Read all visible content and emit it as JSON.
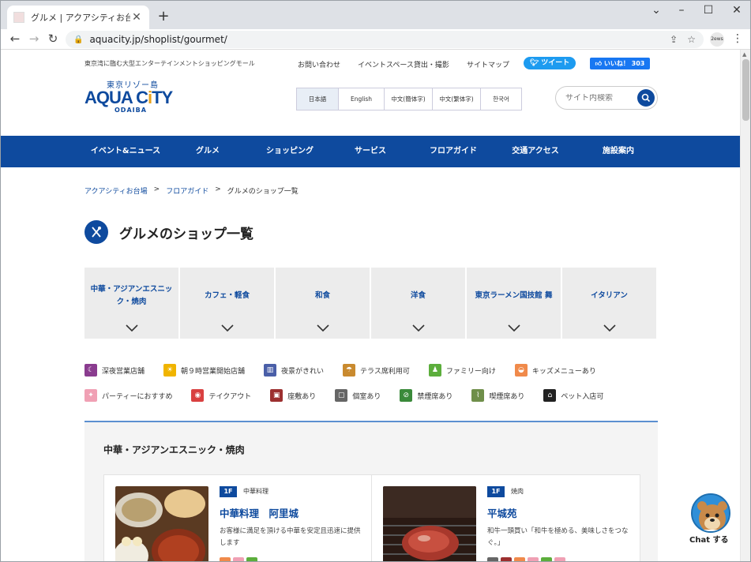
{
  "browser": {
    "tab_title": "グルメ | アクアシティお台場",
    "url": "aquacity.jp/shoplist/gourmet/",
    "extension_label": "2ews"
  },
  "header": {
    "tagline": "東京湾に臨む大型エンターテインメントショッピングモール",
    "logo": {
      "sub": "東京リゾー島",
      "main_a": "AQUA C",
      "main_i": "i",
      "main_b": "TY",
      "odaiba": "ODAIBA"
    },
    "links": [
      "お問い合わせ",
      "イベントスペース貸出・撮影",
      "サイトマップ"
    ],
    "tweet_label": "ツイート",
    "like_label": "いいね！ 303",
    "languages": [
      "日本語",
      "English",
      "中文(簡体字)",
      "中文(繁体字)",
      "한국어"
    ],
    "search_placeholder": "サイト内検索"
  },
  "gnav": [
    "イベント&ニュース",
    "グルメ",
    "ショッピング",
    "サービス",
    "フロアガイド",
    "交通アクセス",
    "施設案内"
  ],
  "breadcrumb": [
    "アクアシティお台場",
    "フロアガイド",
    "グルメのショップ一覧"
  ],
  "page_title": "グルメのショップ一覧",
  "categories": [
    "中華・アジアンエスニック・焼肉",
    "カフェ・軽食",
    "和食",
    "洋食",
    "東京ラーメン国技館 舞",
    "イタリアン"
  ],
  "legend": [
    {
      "label": "深夜営業店舗",
      "color": "#8a3c8f"
    },
    {
      "label": "朝９時営業開始店舗",
      "color": "#f0b400"
    },
    {
      "label": "夜景がきれい",
      "color": "#4a5fa8"
    },
    {
      "label": "テラス席利用可",
      "color": "#c98a2f"
    },
    {
      "label": "ファミリー向け",
      "color": "#5cae3c"
    },
    {
      "label": "キッズメニューあり",
      "color": "#f08a4b"
    },
    {
      "label": "パーティーにおすすめ",
      "color": "#f0a0b4"
    },
    {
      "label": "テイクアウト",
      "color": "#d94040"
    },
    {
      "label": "座敷あり",
      "color": "#9c2f2f"
    },
    {
      "label": "個室あり",
      "color": "#666666"
    },
    {
      "label": "禁煙席あり",
      "color": "#3a8a3a"
    },
    {
      "label": "喫煙席あり",
      "color": "#6f8f4a"
    },
    {
      "label": "ペット入店可",
      "color": "#222222"
    }
  ],
  "section": {
    "title": "中華・アジアンエスニック・焼肉",
    "shops": [
      {
        "floor": "1F",
        "genre": "中華料理",
        "name": "中華料理　阿里城",
        "desc": "お客様に満足を頂ける中華を安定且迅速に提供します"
      },
      {
        "floor": "1F",
        "genre": "焼肉",
        "name": "平城苑",
        "desc": "和牛一頭買い「和牛を極める、美味しさをつなぐ。」"
      }
    ]
  },
  "chat_label": "Chat する"
}
